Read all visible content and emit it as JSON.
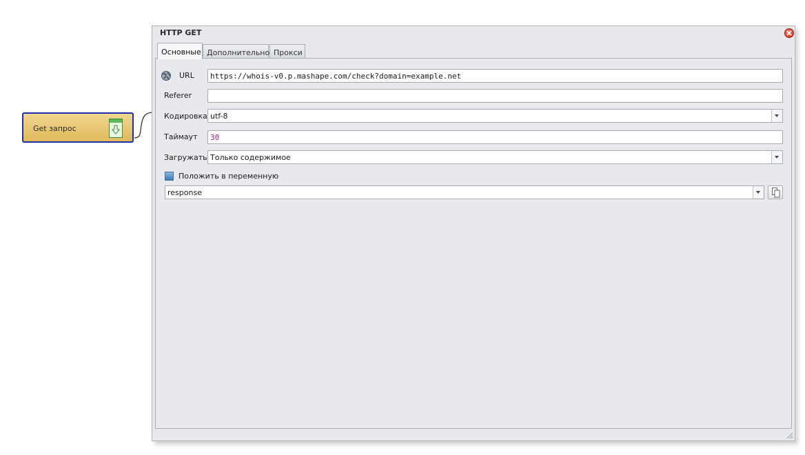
{
  "canvas": {
    "node": {
      "label": "Get запрос",
      "icon": "download-arrow-icon"
    }
  },
  "dialog": {
    "title": "HTTP GET",
    "tabs": [
      {
        "label": "Основные",
        "active": true
      },
      {
        "label": "Дополнительно",
        "active": false
      },
      {
        "label": "Прокси",
        "active": false
      }
    ],
    "url": {
      "label": "URL",
      "value": "https://whois-v0.p.mashape.com/check?domain=example.net",
      "icon": "globe-icon"
    },
    "referer": {
      "label": "Referer",
      "value": ""
    },
    "encoding": {
      "label": "Кодировка",
      "value": "utf-8"
    },
    "timeout": {
      "label": "Таймаут",
      "value": "30"
    },
    "load": {
      "label": "Загружать",
      "value": "Только содержимое"
    },
    "save_to_variable": {
      "label": "Положить в переменную",
      "checked": true,
      "variable": "response"
    }
  },
  "colors": {
    "node_border": "#1f2fa8",
    "node_fill": "#e0ba5a",
    "timeout_text": "#a0269a",
    "close_button": "#d0281c"
  }
}
